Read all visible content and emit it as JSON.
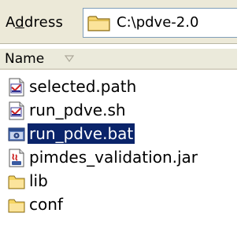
{
  "address_bar": {
    "label": "Address",
    "accesskey_letter": "d",
    "path": "C:\\pdve-2.0"
  },
  "column_header": {
    "name": "Name",
    "sort_icon": "sort-down-triangle-icon"
  },
  "files": [
    {
      "name": "selected.path",
      "icon": "text-file-icon",
      "selected": false
    },
    {
      "name": "run_pdve.sh",
      "icon": "text-file-icon",
      "selected": false
    },
    {
      "name": "run_pdve.bat",
      "icon": "batch-file-icon",
      "selected": true
    },
    {
      "name": "pimdes_validation.jar",
      "icon": "jar-file-icon",
      "selected": false
    },
    {
      "name": "lib",
      "icon": "folder-icon",
      "selected": false
    },
    {
      "name": "conf",
      "icon": "folder-icon",
      "selected": false
    }
  ],
  "colors": {
    "selection_bg": "#0a246a",
    "toolbar_bg": "#ece9d8",
    "folder_yellow": "#f5d562"
  }
}
